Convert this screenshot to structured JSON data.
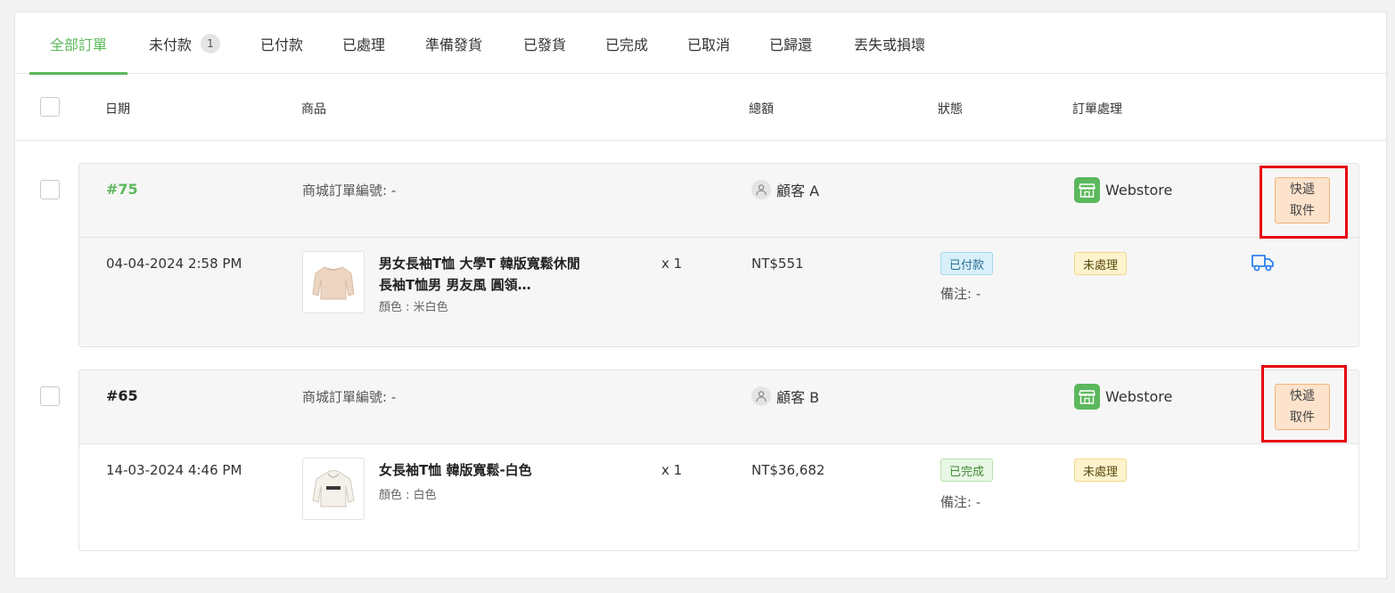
{
  "tabs": [
    {
      "label": "全部訂單",
      "active": true
    },
    {
      "label": "未付款",
      "badge": "1"
    },
    {
      "label": "已付款"
    },
    {
      "label": "已處理"
    },
    {
      "label": "準備發貨"
    },
    {
      "label": "已發貨"
    },
    {
      "label": "已完成"
    },
    {
      "label": "已取消"
    },
    {
      "label": "已歸還"
    },
    {
      "label": "丟失或損壞"
    }
  ],
  "headers": {
    "date": "日期",
    "product": "商品",
    "total": "總額",
    "status": "狀態",
    "processing": "訂單處理"
  },
  "orders": [
    {
      "number": "#75",
      "store_order_label": "商城訂單編號: -",
      "customer": "顧客 A",
      "channel": "Webstore",
      "pickup_label_line1": "快遞",
      "pickup_label_line2": "取件",
      "date": "04-04-2024 2:58 PM",
      "product_name": "男女長袖T恤 大學T 韓版寬鬆休閒長袖T恤男 男友風 圓領…",
      "product_variant": "顏色 : 米白色",
      "quantity": "x 1",
      "amount": "NT$551",
      "payment_status": "已付款",
      "note": "備注: -",
      "processing_status": "未處理",
      "shipping_icon": "truck-icon"
    },
    {
      "number": "#65",
      "store_order_label": "商城訂單編號: -",
      "customer": "顧客 B",
      "channel": "Webstore",
      "pickup_label_line1": "快遞",
      "pickup_label_line2": "取件",
      "date": "14-03-2024 4:46 PM",
      "product_name": "女長袖T恤 韓版寬鬆-白色",
      "product_variant": "顏色 : 白色",
      "quantity": "x 1",
      "amount": "NT$36,682",
      "payment_status": "已完成",
      "note": "備注: -",
      "processing_status": "未處理"
    }
  ],
  "colors": {
    "accent": "#5cb85c",
    "highlight": "#e60012",
    "pickup_bg": "#fde3cc",
    "truck": "#2f80ed"
  }
}
